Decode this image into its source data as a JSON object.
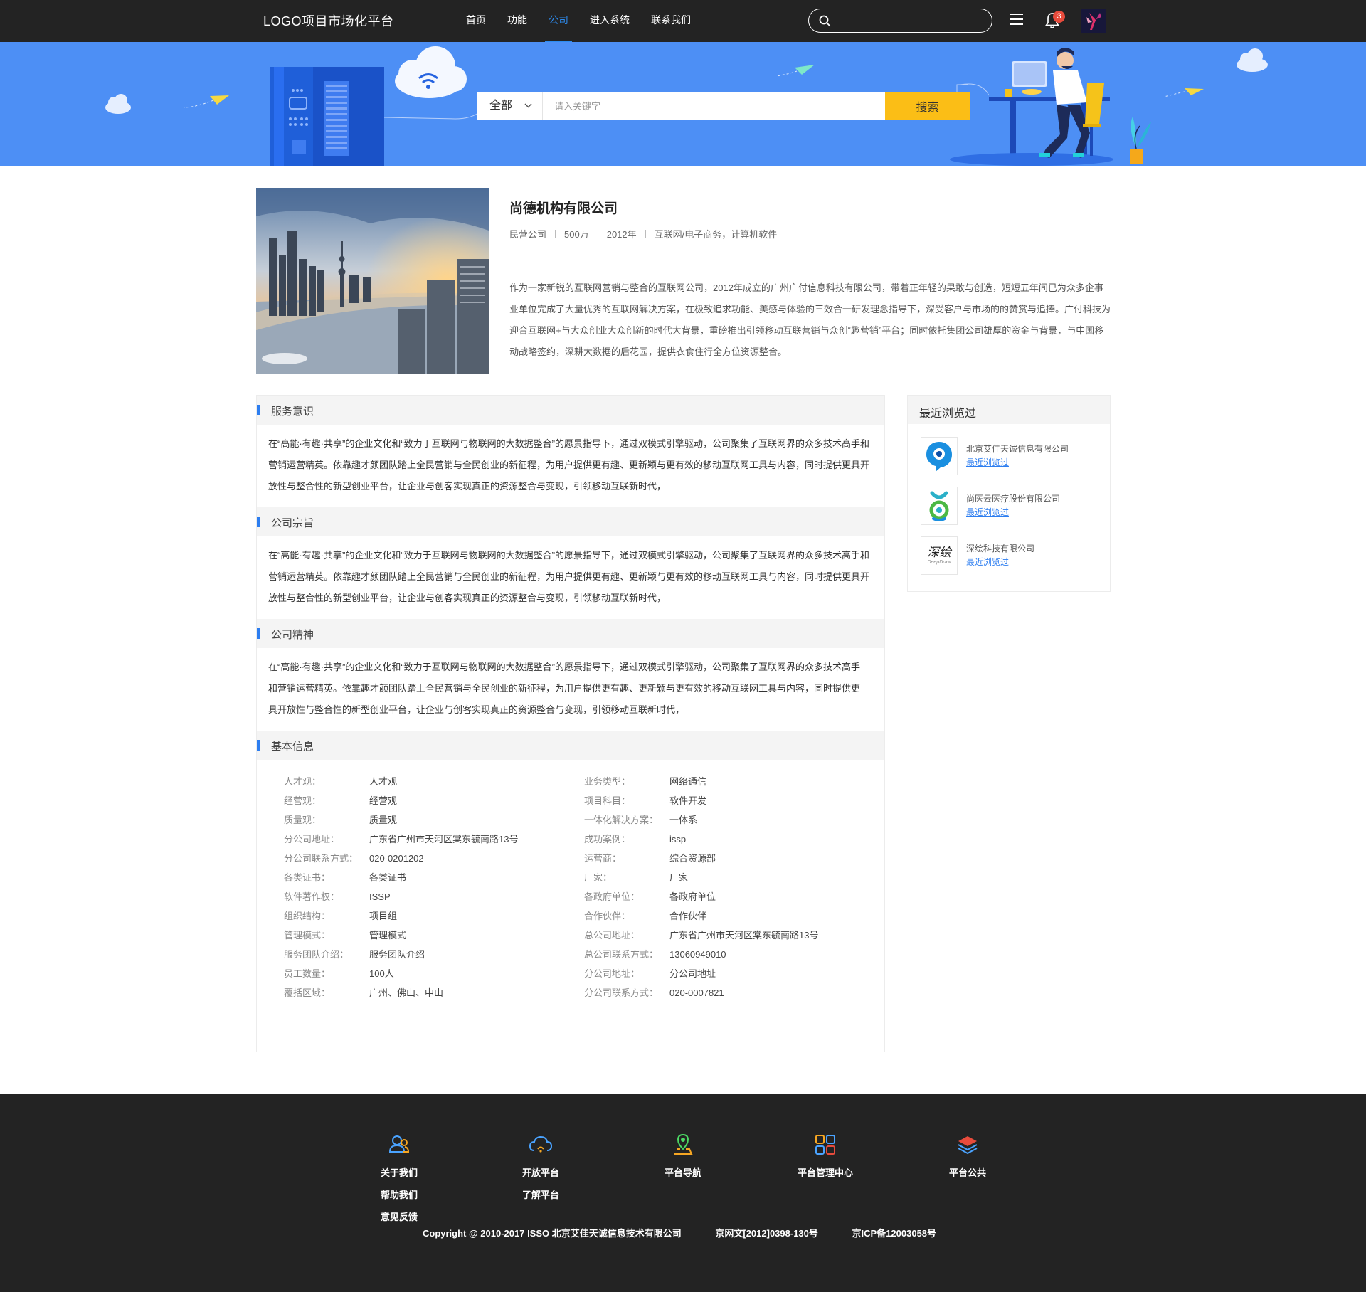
{
  "nav": {
    "logo": "LOGO项目市场化平台",
    "links": [
      "首页",
      "功能",
      "公司",
      "进入系统",
      "联系我们"
    ],
    "active_index": 2,
    "notification_count": "3"
  },
  "banner": {
    "select_label": "全部",
    "search_placeholder": "请入关键字",
    "search_button": "搜索"
  },
  "company": {
    "name": "尚德机构有限公司",
    "meta": [
      "民营公司",
      "500万",
      "2012年",
      "互联网/电子商务，计算机软件"
    ],
    "description": "作为一家新锐的互联网营销与整合的互联网公司，2012年成立的广州广付信息科技有限公司，带着正年轻的果敢与创造，短短五年间已为众多企事业单位完成了大量优秀的互联网解决方案，在极致追求功能、美感与体验的三效合一研发理念指导下，深受客户与市场的的赞赏与追捧。广付科技为迎合互联网+与大众创业大众创新的时代大背景，重磅推出引领移动互联营销与众创“趣营销”平台；同时依托集团公司雄厚的资金与背景，与中国移动战略签约，深耕大数据的后花园，提供衣食住行全方位资源整合。"
  },
  "sections": [
    {
      "title": "服务意识",
      "body": "在“高能·有趣·共享”的企业文化和“致力于互联网与物联网的大数据整合”的愿景指导下，通过双模式引擎驱动，公司聚集了互联网界的众多技术高手和营销运营精英。依靠趣才颜团队踏上全民营销与全民创业的新征程，为用户提供更有趣、更新颖与更有效的移动互联网工具与内容，同时提供更具开放性与整合性的新型创业平台，让企业与创客实现真正的资源整合与变现，引领移动互联新时代，"
    },
    {
      "title": "公司宗旨",
      "body": "在“高能·有趣·共享”的企业文化和“致力于互联网与物联网的大数据整合”的愿景指导下，通过双模式引擎驱动，公司聚集了互联网界的众多技术高手和营销运营精英。依靠趣才颜团队踏上全民营销与全民创业的新征程，为用户提供更有趣、更新颖与更有效的移动互联网工具与内容，同时提供更具开放性与整合性的新型创业平台，让企业与创客实现真正的资源整合与变现，引领移动互联新时代，"
    },
    {
      "title": "公司精神",
      "body": "在“高能·有趣·共享”的企业文化和“致力于互联网与物联网的大数据整合”的愿景指导下，通过双模式引擎驱动，公司聚集了互联网界的众多技术高手和营销运营精英。依靠趣才颜团队踏上全民营销与全民创业的新征程，为用户提供更有趣、更新颖与更有效的移动互联网工具与内容，同时提供更具开放性与整合性的新型创业平台，让企业与创客实现真正的资源整合与变现，引领移动互联新时代，"
    }
  ],
  "basic_info": {
    "title": "基本信息",
    "left": [
      {
        "k": "人才观：",
        "v": "人才观"
      },
      {
        "k": "经营观：",
        "v": "经营观"
      },
      {
        "k": "质量观：",
        "v": "质量观"
      },
      {
        "k": "分公司地址：",
        "v": "广东省广州市天河区棠东毓南路13号"
      },
      {
        "k": "分公司联系方式：",
        "v": "020-0201202"
      },
      {
        "k": "各类证书：",
        "v": "各类证书"
      },
      {
        "k": "软件著作权：",
        "v": "ISSP"
      },
      {
        "k": "组织结构：",
        "v": "项目组"
      },
      {
        "k": "管理模式：",
        "v": "管理模式"
      },
      {
        "k": "服务团队介绍：",
        "v": "服务团队介绍"
      },
      {
        "k": "员工数量：",
        "v": "100人"
      },
      {
        "k": "覆括区域：",
        "v": "广州、佛山、中山"
      }
    ],
    "right": [
      {
        "k": "业务类型：",
        "v": "网络通信"
      },
      {
        "k": "项目科目：",
        "v": "软件开发"
      },
      {
        "k": "一体化解决方案：",
        "v": "一体系"
      },
      {
        "k": "成功案例：",
        "v": "issp"
      },
      {
        "k": "运营商：",
        "v": "综合资源部"
      },
      {
        "k": "厂家：",
        "v": "厂家"
      },
      {
        "k": "各政府单位：",
        "v": "各政府单位"
      },
      {
        "k": "合作伙伴：",
        "v": "合作伙伴"
      },
      {
        "k": "总公司地址：",
        "v": "广东省广州市天河区棠东毓南路13号"
      },
      {
        "k": "总公司联系方式：",
        "v": "13060949010"
      },
      {
        "k": "分公司地址：",
        "v": "分公司地址"
      },
      {
        "k": "分公司联系方式：",
        "v": "020-0007821"
      }
    ]
  },
  "recent": {
    "title": "最近浏览过",
    "items": [
      {
        "name": "北京艾佳天诚信息有限公司",
        "link": "最近浏览过",
        "logo": "blue-drop-logo"
      },
      {
        "name": "尚医云医疗股份有限公司",
        "link": "最近浏览过",
        "logo": "green-figure-logo"
      },
      {
        "name": "深绘科技有限公司",
        "link": "最近浏览过",
        "logo": "deepdraw-logo",
        "logo_text": "深绘",
        "logo_sub": "DeepDraw"
      }
    ]
  },
  "footer": {
    "columns": [
      {
        "icon": "users-icon",
        "links": [
          "关于我们",
          "帮助我们",
          "意见反馈"
        ]
      },
      {
        "icon": "cloud-icon",
        "links": [
          "开放平台",
          "了解平台"
        ]
      },
      {
        "icon": "map-pin-icon",
        "links": [
          "平台导航"
        ]
      },
      {
        "icon": "grid-icon",
        "links": [
          "平台管理中心"
        ]
      },
      {
        "icon": "layers-icon",
        "links": [
          "平台公共"
        ]
      }
    ],
    "copyright": "Copyright @ 2010-2017 ISSO 北京艾佳天诚信息技术有限公司",
    "license1": "京网文[2012]0398-130号",
    "license2": "京ICP备12003058号"
  },
  "colors": {
    "nav_bg": "#232323",
    "banner_bg": "#4d8ff5",
    "accent": "#2d7ef0",
    "search_button": "#fbbe16",
    "badge": "#e84b3c"
  }
}
